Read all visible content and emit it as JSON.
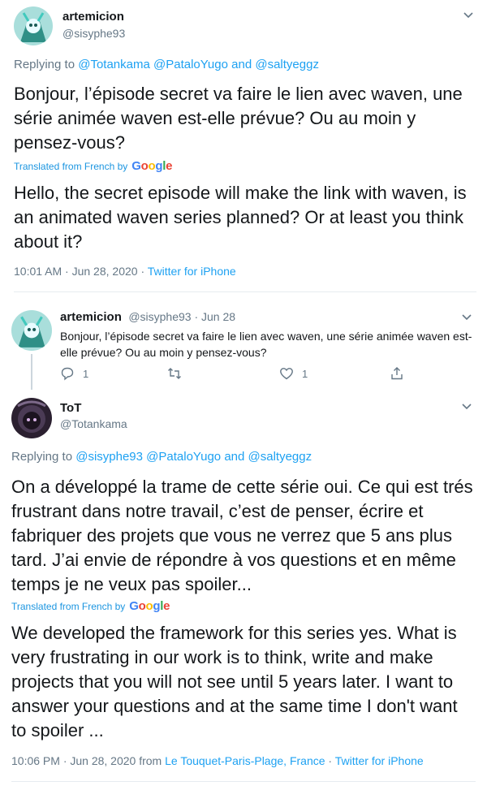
{
  "tweet1": {
    "name": "artemicion",
    "handle": "@sisyphe93",
    "replying_prefix": "Replying to",
    "replying_users": [
      "@Totankama",
      "@PataloYugo"
    ],
    "replying_and": "and",
    "replying_last": "@saltyeggz",
    "text": "Bonjour, l’épisode secret va faire le lien avec waven, une série animée waven est-elle prévue? Ou au moin y pensez-vous?",
    "translated_label": "Translated from French by",
    "translation": "Hello, the secret episode will make the link with waven, is an animated waven series planned? Or at least you think about it?",
    "time": "10:01 AM · Jun 28, 2020 ·",
    "source": "Twitter for iPhone"
  },
  "tweet2": {
    "name": "artemicion",
    "handle_date": "@sisyphe93 · Jun 28",
    "text": "Bonjour, l’épisode secret va faire le lien avec waven, une série animée waven est-elle prévue? Ou au moin y pensez-vous?",
    "replies": "1",
    "likes": "1"
  },
  "tweet3": {
    "name": "ToT",
    "handle": "@Totankama",
    "replying_prefix": "Replying to",
    "replying_users": [
      "@sisyphe93",
      "@PataloYugo"
    ],
    "replying_and": "and",
    "replying_last": "@saltyeggz",
    "text": "On a développé la trame de cette série oui. Ce qui est trés frustrant dans notre travail, c’est de penser, écrire et fabriquer des projets que vous ne verrez que 5 ans plus tard. J’ai envie de répondre à vos questions et en même temps je ne veux pas spoiler...",
    "translated_label": "Translated from French by",
    "translation": "We developed the framework for this series yes. What is very frustrating in our work is to think, write and make projects that you will not see until 5 years later. I want to answer your questions and at the same time I don't want to spoiler ...",
    "time": "10:06 PM · Jun 28, 2020 from",
    "location": "Le Touquet-Paris-Plage, France",
    "sep": "·",
    "source": "Twitter for iPhone"
  },
  "google": {
    "letters": [
      "G",
      "o",
      "o",
      "g",
      "l",
      "e"
    ]
  },
  "icons": {
    "chevron": "chevron-down-icon",
    "reply": "reply-icon",
    "retweet": "retweet-icon",
    "like": "heart-icon",
    "share": "share-icon"
  },
  "colors": {
    "link": "#1da1f2",
    "gray": "#657786",
    "divider": "#e6ecf0"
  }
}
